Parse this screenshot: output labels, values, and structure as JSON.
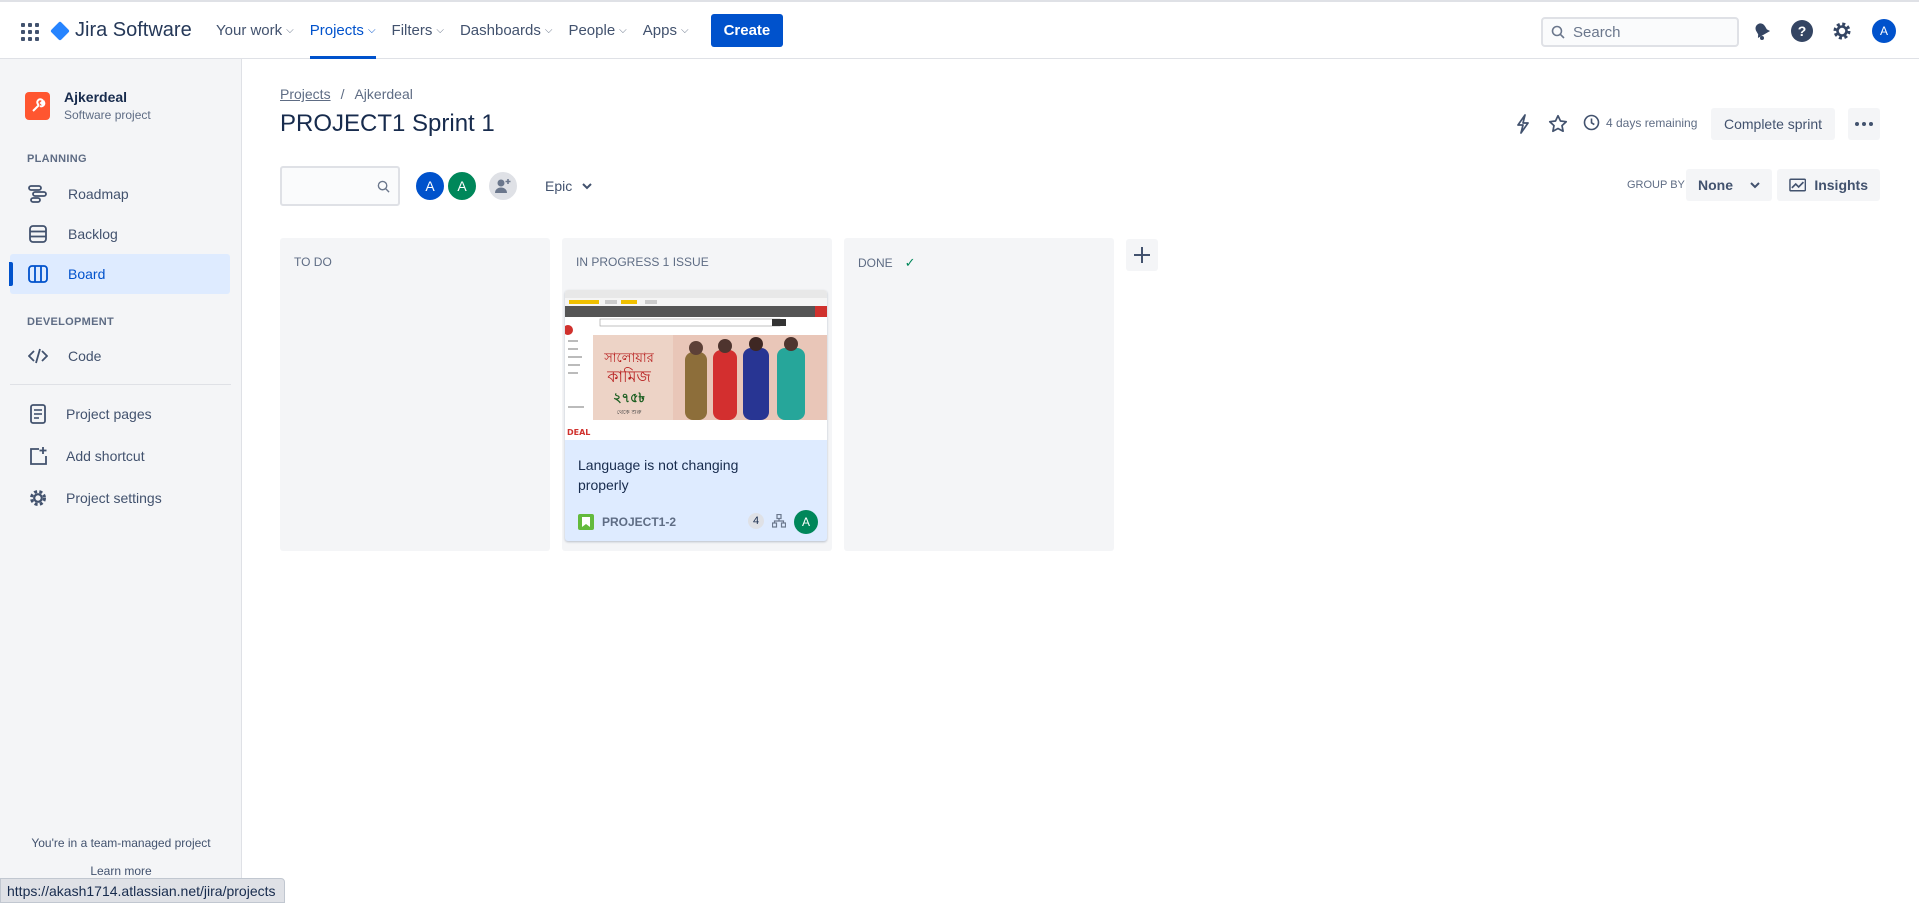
{
  "app": {
    "name": "Jira Software"
  },
  "topnav": {
    "items": [
      {
        "label": "Your work",
        "active": false
      },
      {
        "label": "Projects",
        "active": true
      },
      {
        "label": "Filters",
        "active": false
      },
      {
        "label": "Dashboards",
        "active": false
      },
      {
        "label": "People",
        "active": false
      },
      {
        "label": "Apps",
        "active": false
      }
    ],
    "create_label": "Create",
    "search_placeholder": "Search",
    "user_initial": "A"
  },
  "sidebar": {
    "project_name": "Ajkerdeal",
    "project_type": "Software project",
    "planning_label": "PLANNING",
    "planning_items": [
      {
        "label": "Roadmap",
        "icon": "roadmap-icon"
      },
      {
        "label": "Backlog",
        "icon": "backlog-icon"
      },
      {
        "label": "Board",
        "icon": "board-icon",
        "active": true
      }
    ],
    "development_label": "DEVELOPMENT",
    "development_items": [
      {
        "label": "Code",
        "icon": "code-icon"
      }
    ],
    "other_items": [
      {
        "label": "Project pages",
        "icon": "pages-icon"
      },
      {
        "label": "Add shortcut",
        "icon": "add-shortcut-icon"
      },
      {
        "label": "Project settings",
        "icon": "gear-icon"
      }
    ],
    "footer_text": "You're in a team-managed project",
    "footer_link": "Learn more"
  },
  "breadcrumb": {
    "root": "Projects",
    "current": "Ajkerdeal"
  },
  "page_title": "PROJECT1 Sprint 1",
  "sprint": {
    "remaining": "4 days remaining",
    "complete_label": "Complete sprint"
  },
  "filters": {
    "avatars": [
      {
        "initial": "A",
        "color": "#0052cc"
      },
      {
        "initial": "A",
        "color": "#00875a"
      }
    ],
    "epic_label": "Epic",
    "group_by_label": "GROUP BY",
    "group_by_value": "None",
    "insights_label": "Insights"
  },
  "columns": [
    {
      "title": "TO DO",
      "check": ""
    },
    {
      "title": "IN PROGRESS 1 ISSUE",
      "check": ""
    },
    {
      "title": "DONE",
      "check": "✓"
    }
  ],
  "card": {
    "title": "Language is not changing properly",
    "key": "PROJECT1-2",
    "points": "4",
    "assignee_initial": "A",
    "image_text": {
      "banner_line1": "সালোয়ার",
      "banner_line2": "কামিজ",
      "price": "২৭৫৳",
      "price_note": "থেকে শুরু",
      "deal": "DEAL"
    }
  },
  "status_bar": {
    "url": "https://akash1714.atlassian.net/jira/projects"
  },
  "colors": {
    "accent": "#0052cc",
    "sidebar_bg": "#f4f5f7",
    "card_bg": "#deebff"
  }
}
